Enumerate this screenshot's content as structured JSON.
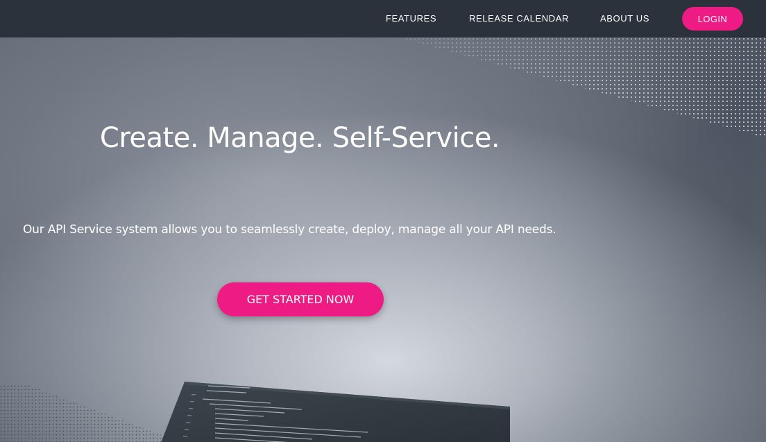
{
  "nav": {
    "links": [
      {
        "label": "FEATURES"
      },
      {
        "label": "RELEASE CALENDAR"
      },
      {
        "label": "ABOUT US"
      }
    ],
    "login_label": "LOGIN"
  },
  "hero": {
    "title": "Create. Manage. Self-Service.",
    "subtitle": "Our API Service system allows you to seamlessly create, deploy, manage all your API needs.",
    "cta_label": "GET STARTED NOW"
  },
  "colors": {
    "accent": "#ef1b85",
    "navbar": "#2b323c",
    "text": "#ffffff"
  },
  "icons": {
    "background_image": "laptop-code-screen"
  }
}
